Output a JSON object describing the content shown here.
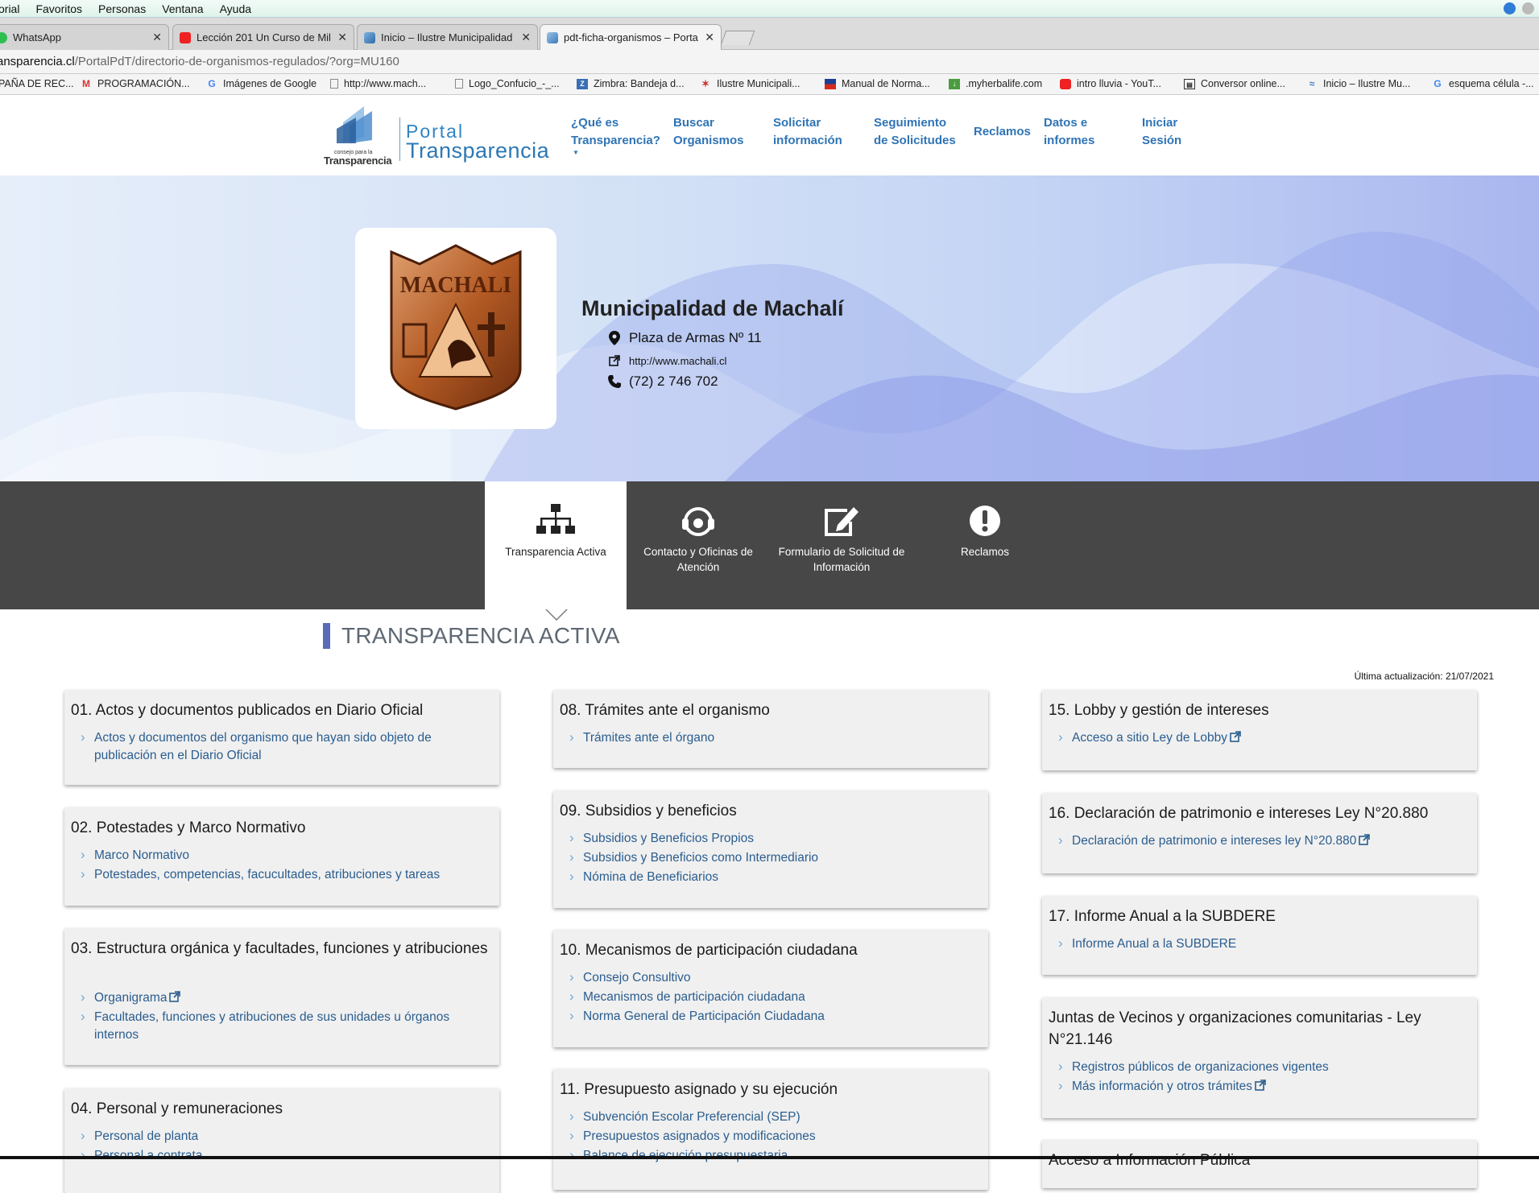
{
  "menubar": {
    "items": [
      "orial",
      "Favoritos",
      "Personas",
      "Ventana",
      "Ayuda"
    ]
  },
  "browser_tabs": [
    {
      "title": "WhatsApp",
      "active": false
    },
    {
      "title": "Lección 201 Un Curso de Mila",
      "active": false
    },
    {
      "title": "Inicio – Ilustre Municipalidad",
      "active": false
    },
    {
      "title": "pdt-ficha-organismos – Porta",
      "active": true
    }
  ],
  "url": {
    "host": "ansparencia.cl",
    "path": "/PortalPdT/directorio-de-organismos-regulados/?org=MU160"
  },
  "bookmarks": [
    {
      "label": "PAÑA DE REC...",
      "icon": "none"
    },
    {
      "label": "PROGRAMACIÓN...",
      "icon": "gmail-icon"
    },
    {
      "label": "Imágenes de Google",
      "icon": "google-icon"
    },
    {
      "label": "http://www.mach...",
      "icon": "page-icon"
    },
    {
      "label": "Logo_Confucio_-_...",
      "icon": "page-icon"
    },
    {
      "label": "Zimbra: Bandeja d...",
      "icon": "zimbra-icon"
    },
    {
      "label": "Ilustre Municipali...",
      "icon": "star-icon"
    },
    {
      "label": "Manual de Norma...",
      "icon": "flag-icon"
    },
    {
      "label": ".myherbalife.com",
      "icon": "download-icon"
    },
    {
      "label": "intro lluvia - YouT...",
      "icon": "youtube-icon"
    },
    {
      "label": "Conversor online...",
      "icon": "converter-icon"
    },
    {
      "label": "Inicio – Ilustre Mu...",
      "icon": "wave-icon"
    },
    {
      "label": "esquema célula -...",
      "icon": "google-icon"
    }
  ],
  "site": {
    "logo_small": "consejo para la",
    "logo_brand": "Transparencia",
    "logo_portal": "Portal",
    "logo_transparencia": "Transparencia",
    "nav": [
      {
        "line1": "¿Qué es",
        "line2": "Transparencia?",
        "caret": true
      },
      {
        "line1": "Buscar",
        "line2": "Organismos",
        "caret": false
      },
      {
        "line1": "Solicitar",
        "line2": "información",
        "caret": false
      },
      {
        "line1": "Seguimiento",
        "line2": "de Solicitudes",
        "caret": false
      },
      {
        "line1": "Reclamos",
        "line2": "",
        "caret": false
      },
      {
        "line1": "Datos e",
        "line2": "informes",
        "caret": false
      },
      {
        "line1": "Iniciar",
        "line2": "Sesión",
        "caret": false
      }
    ]
  },
  "organism": {
    "name": "Municipalidad de Machalí",
    "address": "Plaza de Armas Nº 11",
    "website": "http://www.machali.cl",
    "phone": "(72) 2 746 702",
    "logo_text": "MACHALI"
  },
  "section_tabs": [
    {
      "label": "Transparencia Activa",
      "icon": "org-chart-icon",
      "active": true
    },
    {
      "label": "Contacto y Oficinas de Atención",
      "icon": "headset-icon",
      "active": false
    },
    {
      "label": "Formulario de Solicitud de Información",
      "icon": "edit-form-icon",
      "active": false
    },
    {
      "label": "Reclamos",
      "icon": "exclamation-icon",
      "active": false
    }
  ],
  "section": {
    "title": "TRANSPARENCIA ACTIVA",
    "last_update": "Última actualización: 21/07/2021"
  },
  "cards": {
    "c01": {
      "title": "01. Actos y documentos publicados en Diario Oficial",
      "items": [
        {
          "text": "Actos y documentos del organismo que hayan sido objeto de publicación en el Diario Oficial",
          "external": false
        }
      ]
    },
    "c02": {
      "title": "02. Potestades y Marco Normativo",
      "items": [
        {
          "text": "Marco Normativo",
          "external": false
        },
        {
          "text": "Potestades, competencias, facucultades, atribuciones y tareas",
          "external": false
        }
      ]
    },
    "c03": {
      "title": "03. Estructura orgánica y facultades, funciones y atribuciones",
      "items": [
        {
          "text": "Organigrama",
          "external": true
        },
        {
          "text": "Facultades, funciones y atribuciones de sus unidades u órganos internos",
          "external": false
        }
      ]
    },
    "c04": {
      "title": "04. Personal y remuneraciones",
      "items": [
        {
          "text": "Personal de planta",
          "external": false
        },
        {
          "text": "Personal a contrata",
          "external": false
        }
      ]
    },
    "c08": {
      "title": "08. Trámites ante el organismo",
      "items": [
        {
          "text": "Trámites ante el órgano",
          "external": false
        }
      ]
    },
    "c09": {
      "title": "09. Subsidios y beneficios",
      "items": [
        {
          "text": "Subsidios y Beneficios Propios",
          "external": false
        },
        {
          "text": "Subsidios y Beneficios como Intermediario",
          "external": false
        },
        {
          "text": "Nómina de Beneficiarios",
          "external": false
        }
      ]
    },
    "c10": {
      "title": "10. Mecanismos de participación ciudadana",
      "items": [
        {
          "text": "Consejo Consultivo",
          "external": false
        },
        {
          "text": "Mecanismos de participación ciudadana",
          "external": false
        },
        {
          "text": "Norma General de Participación Ciudadana",
          "external": false
        }
      ]
    },
    "c11": {
      "title": "11. Presupuesto asignado y su ejecución",
      "items": [
        {
          "text": "Subvención Escolar Preferencial (SEP)",
          "external": false
        },
        {
          "text": "Presupuestos asignados y modificaciones",
          "external": false
        },
        {
          "text": "Balance de ejecución presupuestaria",
          "external": false
        }
      ]
    },
    "c15": {
      "title": "15. Lobby y gestión de intereses",
      "items": [
        {
          "text": "Acceso a sitio Ley de Lobby",
          "external": true
        }
      ]
    },
    "c16": {
      "title": "16. Declaración de patrimonio e intereses Ley N°20.880",
      "items": [
        {
          "text": "Declaración de patrimonio e intereses ley N°20.880",
          "external": true
        }
      ]
    },
    "c17": {
      "title": "17. Informe Anual a la SUBDERE",
      "items": [
        {
          "text": "Informe Anual a la SUBDERE",
          "external": false
        }
      ]
    },
    "cJV": {
      "title": "Juntas de Vecinos y organizaciones comunitarias - Ley N°21.146",
      "items": [
        {
          "text": "Registros públicos de organizaciones vigentes",
          "external": false
        },
        {
          "text": "Más información y otros trámites",
          "external": true
        }
      ]
    },
    "cAIP": {
      "title": "Acceso a Información Pública",
      "items": []
    }
  }
}
